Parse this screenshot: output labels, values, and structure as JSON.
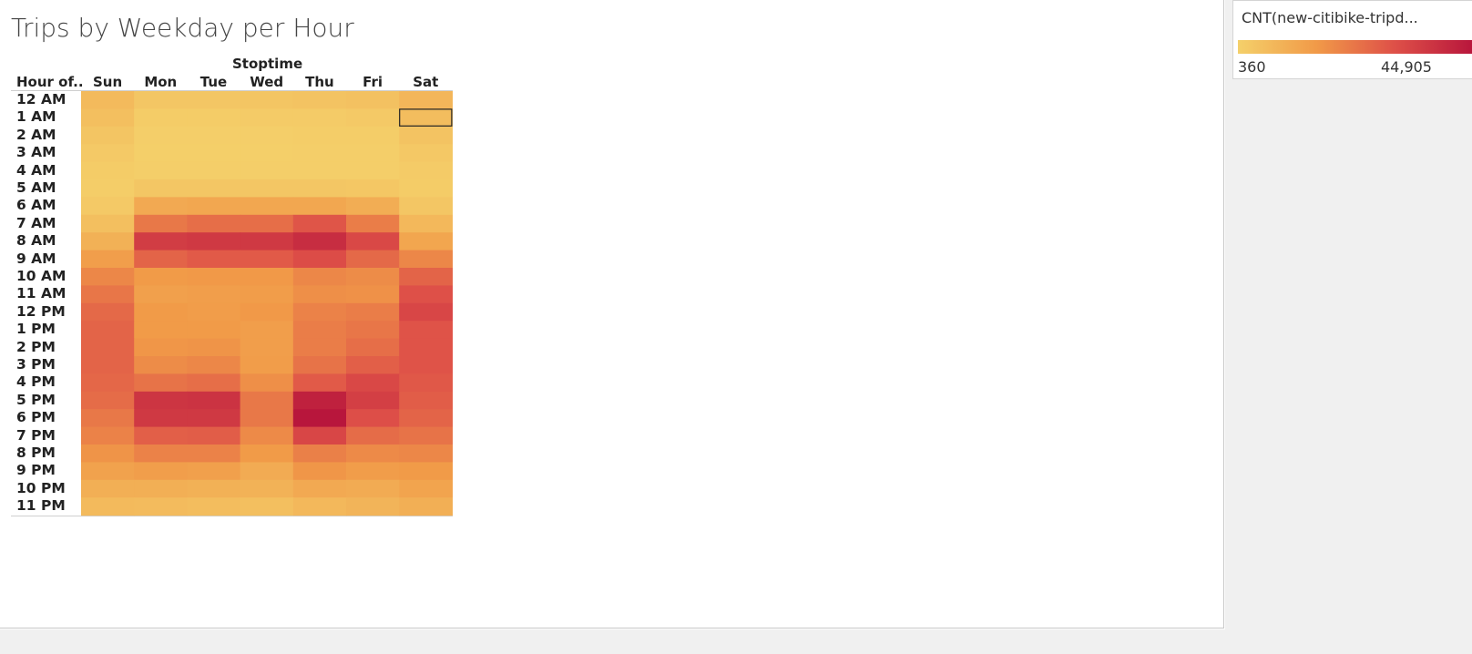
{
  "title": "Trips by Weekday per Hour",
  "column_field": "Stoptime",
  "row_field": "Hour of..",
  "legend": {
    "title": "CNT(new-citibike-tripd...",
    "min_label": "360",
    "max_label": "44,905",
    "colors": [
      "#f4d06a",
      "#f19a48",
      "#de5048",
      "#b8163c"
    ]
  },
  "chart_data": {
    "type": "heatmap",
    "title": "Trips by Weekday per Hour",
    "x_field": "Stoptime",
    "y_field": "Hour of..",
    "x": [
      "Sun",
      "Mon",
      "Tue",
      "Wed",
      "Thu",
      "Fri",
      "Sat"
    ],
    "y": [
      "12 AM",
      "1 AM",
      "2 AM",
      "3 AM",
      "4 AM",
      "5 AM",
      "6 AM",
      "7 AM",
      "8 AM",
      "9 AM",
      "10 AM",
      "11 AM",
      "12 PM",
      "1 PM",
      "2 PM",
      "3 PM",
      "4 PM",
      "5 PM",
      "6 PM",
      "7 PM",
      "8 PM",
      "9 PM",
      "10 PM",
      "11 PM"
    ],
    "values": [
      [
        6500,
        3000,
        3000,
        3500,
        4000,
        4500,
        7500
      ],
      [
        5000,
        1500,
        1500,
        1700,
        1800,
        2200,
        5500
      ],
      [
        3500,
        900,
        900,
        1000,
        1100,
        1300,
        4000
      ],
      [
        2200,
        700,
        700,
        750,
        800,
        900,
        2500
      ],
      [
        1500,
        800,
        800,
        850,
        850,
        900,
        1700
      ],
      [
        1300,
        3000,
        3000,
        3000,
        3000,
        2800,
        1500
      ],
      [
        2200,
        11000,
        11500,
        11500,
        11500,
        10000,
        3000
      ],
      [
        5000,
        22000,
        24000,
        24000,
        29000,
        21000,
        7000
      ],
      [
        9000,
        35000,
        36000,
        36000,
        39000,
        32000,
        12000
      ],
      [
        14000,
        26000,
        28000,
        28000,
        31000,
        25000,
        19000
      ],
      [
        19000,
        15000,
        15500,
        15500,
        19000,
        18000,
        26000
      ],
      [
        22500,
        13500,
        14000,
        14500,
        17500,
        17000,
        30000
      ],
      [
        25000,
        15000,
        14500,
        15500,
        20000,
        21000,
        32500
      ],
      [
        26000,
        15000,
        15000,
        14000,
        21000,
        22500,
        29500
      ],
      [
        26000,
        16000,
        16500,
        14000,
        21000,
        24000,
        29500
      ],
      [
        26000,
        18000,
        19000,
        14500,
        23000,
        27000,
        29500
      ],
      [
        25500,
        23000,
        24000,
        17500,
        28000,
        32000,
        28500
      ],
      [
        24500,
        37000,
        37500,
        22000,
        42000,
        34500,
        27500
      ],
      [
        22000,
        36000,
        36000,
        22000,
        44905,
        30500,
        26000
      ],
      [
        20000,
        27000,
        27500,
        18500,
        32500,
        24500,
        23000
      ],
      [
        16500,
        20000,
        20000,
        15000,
        20500,
        18500,
        19000
      ],
      [
        13000,
        14000,
        13500,
        10500,
        16000,
        14500,
        15000
      ],
      [
        9500,
        9500,
        9000,
        8500,
        11000,
        10500,
        12500
      ],
      [
        6500,
        6000,
        5500,
        5000,
        7000,
        8000,
        9500
      ]
    ],
    "color_range": [
      360,
      44905
    ],
    "selected_cell": {
      "x": "Sat",
      "y": "1 AM"
    }
  }
}
